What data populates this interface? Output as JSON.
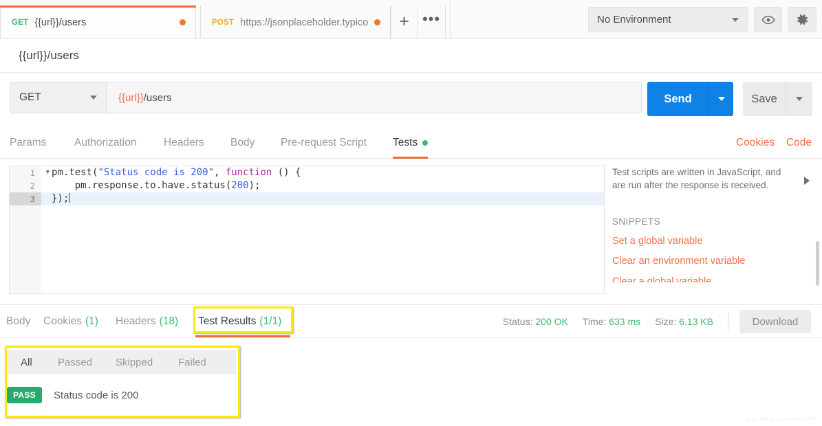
{
  "topbar": {
    "tabs": [
      {
        "method": "GET",
        "name": "{{url}}/users",
        "unsaved": true,
        "active": true
      },
      {
        "method": "POST",
        "name": "https://jsonplaceholder.typicod",
        "unsaved": true,
        "active": false
      }
    ],
    "new_tab_label": "+",
    "more_label": "•••",
    "environment": "No Environment",
    "eye_icon": "eye-icon",
    "gear_icon": "gear-icon"
  },
  "request": {
    "name": "{{url}}/users",
    "method": "GET",
    "url_variable": "{{url}}",
    "url_rest": "/users",
    "url_full": "{{url}}/users",
    "send_label": "Send",
    "save_label": "Save"
  },
  "request_tabs": {
    "items": [
      {
        "label": "Params",
        "active": false,
        "dot": false
      },
      {
        "label": "Authorization",
        "active": false,
        "dot": false
      },
      {
        "label": "Headers",
        "active": false,
        "dot": false
      },
      {
        "label": "Body",
        "active": false,
        "dot": false
      },
      {
        "label": "Pre-request Script",
        "active": false,
        "dot": false
      },
      {
        "label": "Tests",
        "active": true,
        "dot": true
      }
    ],
    "cookies_link": "Cookies",
    "code_link": "Code"
  },
  "editor": {
    "lines": [
      {
        "num": "1",
        "fold": true,
        "current": false
      },
      {
        "num": "2",
        "fold": false,
        "current": false
      },
      {
        "num": "3",
        "fold": false,
        "current": true
      }
    ],
    "code": {
      "l1_a": "pm.test(",
      "l1_str": "\"Status code is 200\"",
      "l1_b": ", ",
      "l1_kw": "function",
      "l1_c": " () {",
      "l2_a": "    pm.response.to.have.status(",
      "l2_num": "200",
      "l2_b": ");",
      "l3_a": "});"
    }
  },
  "snippets": {
    "description": "Test scripts are written in JavaScript, and are run after the response is received.",
    "heading": "SNIPPETS",
    "items": [
      "Set a global variable",
      "Clear an environment variable",
      "Clear a global variable"
    ]
  },
  "response": {
    "tabs": [
      {
        "label": "Body",
        "count": "",
        "active": false
      },
      {
        "label": "Cookies",
        "count": "(1)",
        "active": false
      },
      {
        "label": "Headers",
        "count": "(18)",
        "active": false
      },
      {
        "label": "Test Results",
        "count": "(1/1)",
        "active": true
      }
    ],
    "status_label": "Status:",
    "status_value": "200 OK",
    "time_label": "Time:",
    "time_value": "633 ms",
    "size_label": "Size:",
    "size_value": "6.13 KB",
    "download_label": "Download"
  },
  "test_results": {
    "filters": [
      {
        "label": "All",
        "active": true
      },
      {
        "label": "Passed",
        "active": false
      },
      {
        "label": "Skipped",
        "active": false
      },
      {
        "label": "Failed",
        "active": false
      }
    ],
    "rows": [
      {
        "status": "PASS",
        "name": "Status code is 200"
      }
    ]
  },
  "watermark": "https://blog.csdn.net/zbj1234",
  "colors": {
    "accent_orange": "#f06a35",
    "send_blue": "#0f82e8",
    "green": "#3eb96f",
    "highlight_yellow": "#ffeb00",
    "pass_green": "#2aaa6e"
  }
}
